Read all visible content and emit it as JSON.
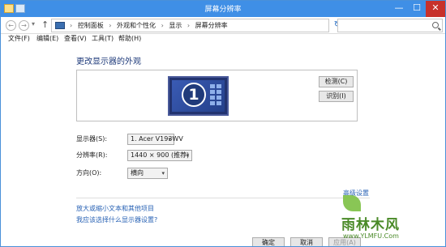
{
  "window": {
    "title": "屏幕分辨率",
    "minimize_glyph": "—",
    "maximize_glyph": "☐",
    "close_glyph": "✕"
  },
  "nav": {
    "back_glyph": "←",
    "forward_glyph": "→",
    "history_glyph": "▾",
    "up_glyph": "↑",
    "breadcrumbs": [
      "控制面板",
      "外观和个性化",
      "显示",
      "屏幕分辨率"
    ],
    "crumb_separator": "›",
    "address_dropdown_glyph": "▾",
    "refresh_glyph": "↻",
    "search_placeholder": ""
  },
  "menu": {
    "items": [
      "文件(F)",
      "编辑(E)",
      "查看(V)",
      "工具(T)",
      "帮助(H)"
    ]
  },
  "main": {
    "heading": "更改显示器的外观",
    "monitor_number": "1",
    "detect_label": "检测(C)",
    "identify_label": "识别(I)",
    "display_label": "显示器(S):",
    "display_value": "1. Acer V193WV",
    "resolution_label": "分辨率(R):",
    "resolution_value": "1440 × 900 (推荐)",
    "orientation_label": "方向(O):",
    "orientation_value": "横向",
    "dropdown_glyph": "▾",
    "advanced_link": "高级设置",
    "link_text_size": "放大或缩小文本和其他项目",
    "link_choose": "我应该选择什么显示器设置?"
  },
  "buttons": {
    "ok": "确定",
    "cancel": "取消",
    "apply": "应用(A)"
  },
  "watermark": {
    "brand": "雨林木风",
    "url": "www.YLMFU.Com"
  },
  "colors": {
    "titlebar": "#3f8fe6",
    "close": "#c7312b",
    "link": "#2a63b5",
    "heading": "#1e3a7a",
    "monitor": "#22336f"
  }
}
